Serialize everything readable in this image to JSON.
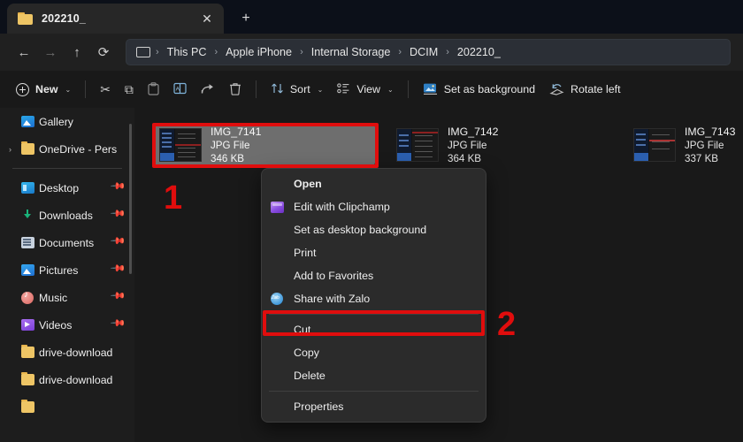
{
  "window": {
    "tab": {
      "title": "202210_",
      "folder_icon": "folder-icon",
      "close_icon": "✕"
    },
    "new_tab_icon": "+"
  },
  "nav": {
    "back_icon": "←",
    "forward_icon": "→",
    "up_icon": "↑",
    "refresh_icon": "⟳",
    "breadcrumb": {
      "root_icon": "this-pc-icon",
      "separator": "›",
      "items": [
        "This PC",
        "Apple iPhone",
        "Internal Storage",
        "DCIM",
        "202210_"
      ]
    }
  },
  "toolbar": {
    "new_label": "New",
    "new_chevron": "⌄",
    "cut_icon": "✂",
    "copy_icon": "⧉",
    "paste_icon": "📋",
    "rename_icon": "rename-icon",
    "share_icon": "share-icon",
    "delete_icon": "🗑",
    "sort_icon": "⇅",
    "sort_label": "Sort",
    "sort_chevron": "⌄",
    "view_icon": "view-icon",
    "view_label": "View",
    "view_chevron": "⌄",
    "set_background_icon": "image-icon",
    "set_background_label": "Set as background",
    "rotate_left_icon": "rotate-left-icon",
    "rotate_left_label": "Rotate left"
  },
  "sidebar": {
    "items": [
      {
        "label": "Gallery",
        "icon": "gallery-icon",
        "chevron": "",
        "pinned": false
      },
      {
        "label": "OneDrive - Pers",
        "icon": "folder-icon",
        "chevron": "›",
        "pinned": false
      },
      {
        "divider": true
      },
      {
        "label": "Desktop",
        "icon": "desktop-icon",
        "chevron": "",
        "pinned": true,
        "pin": "📌"
      },
      {
        "label": "Downloads",
        "icon": "downloads-icon",
        "chevron": "",
        "pinned": true,
        "pin": "📌"
      },
      {
        "label": "Documents",
        "icon": "documents-icon",
        "chevron": "",
        "pinned": true,
        "pin": "📌"
      },
      {
        "label": "Pictures",
        "icon": "pictures-icon",
        "chevron": "",
        "pinned": true,
        "pin": "📌"
      },
      {
        "label": "Music",
        "icon": "music-icon",
        "chevron": "",
        "pinned": true,
        "pin": "📌"
      },
      {
        "label": "Videos",
        "icon": "videos-icon",
        "chevron": "",
        "pinned": true,
        "pin": "📌"
      },
      {
        "label": "drive-download",
        "icon": "folder-icon",
        "chevron": "",
        "pinned": false
      },
      {
        "label": "drive-download",
        "icon": "folder-icon",
        "chevron": "",
        "pinned": false
      }
    ]
  },
  "files": [
    {
      "name": "IMG_7141",
      "type": "JPG File",
      "size": "346 KB",
      "selected": true
    },
    {
      "name": "IMG_7142",
      "type": "JPG File",
      "size": "364 KB",
      "selected": false
    },
    {
      "name": "IMG_7143",
      "type": "JPG File",
      "size": "337 KB",
      "selected": false
    }
  ],
  "context_menu": {
    "items": [
      {
        "label": "Open",
        "icon": "",
        "bold": true
      },
      {
        "label": "Edit with Clipchamp",
        "icon": "clipchamp-icon",
        "bold": false
      },
      {
        "label": "Set as desktop background",
        "icon": "",
        "bold": false
      },
      {
        "label": "Print",
        "icon": "",
        "bold": false
      },
      {
        "label": "Add to Favorites",
        "icon": "",
        "bold": false
      },
      {
        "label": "Share with Zalo",
        "icon": "zalo-icon",
        "bold": false
      },
      {
        "separator": true
      },
      {
        "label": "Cut",
        "icon": "",
        "bold": false
      },
      {
        "label": "Copy",
        "icon": "",
        "bold": false,
        "highlighted": true
      },
      {
        "label": "Delete",
        "icon": "",
        "bold": false
      },
      {
        "separator": true
      },
      {
        "label": "Properties",
        "icon": "",
        "bold": false
      }
    ]
  },
  "annotations": {
    "color": "#e00d0d",
    "step_one": "1",
    "step_two": "2"
  }
}
